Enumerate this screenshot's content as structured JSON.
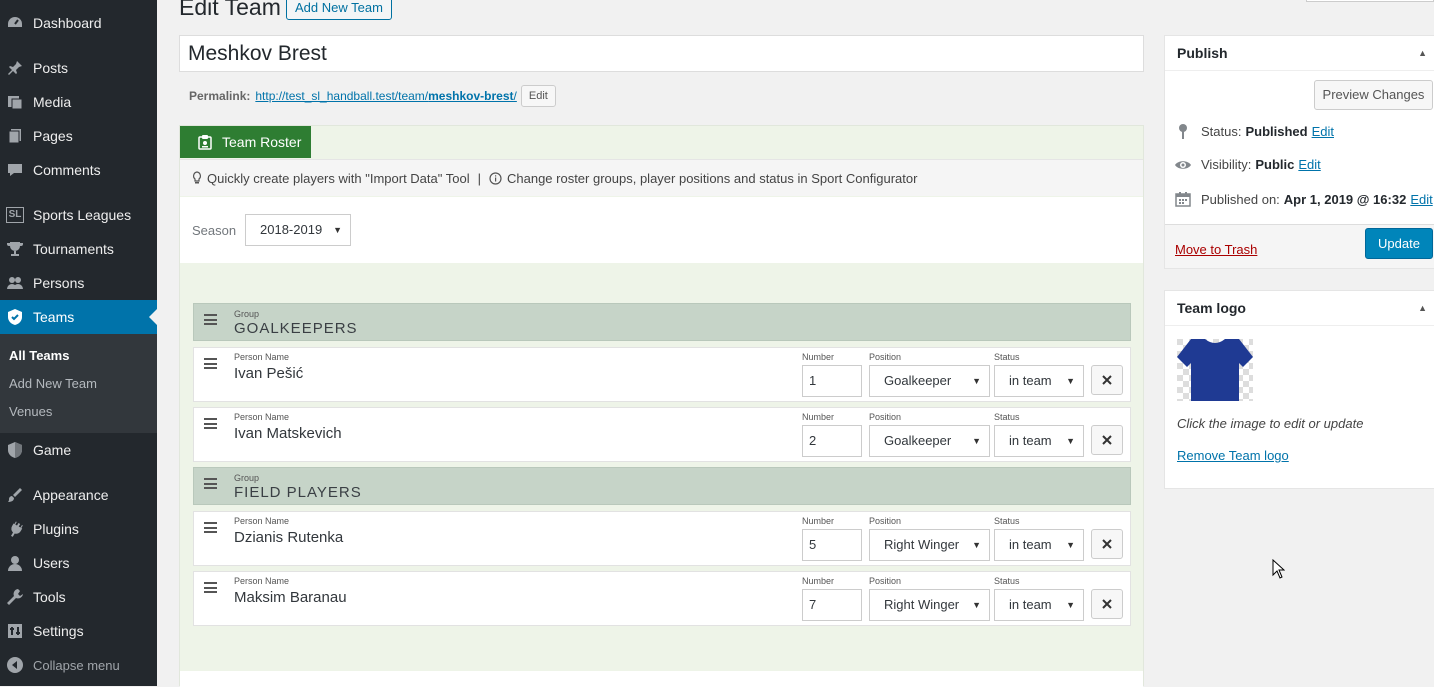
{
  "sidebar": {
    "items": [
      {
        "label": "Dashboard",
        "icon": "dashboard-icon"
      },
      {
        "label": "Posts",
        "icon": "pushpin-icon"
      },
      {
        "label": "Media",
        "icon": "media-icon"
      },
      {
        "label": "Pages",
        "icon": "pages-icon"
      },
      {
        "label": "Comments",
        "icon": "comment-icon"
      },
      {
        "label": "Sports Leagues",
        "icon": "sl-icon",
        "icon_text": "SL"
      },
      {
        "label": "Tournaments",
        "icon": "trophy-icon"
      },
      {
        "label": "Persons",
        "icon": "persons-icon"
      },
      {
        "label": "Teams",
        "icon": "shield-icon",
        "active": true
      },
      {
        "label": "Game",
        "icon": "shield-half-icon"
      },
      {
        "label": "Appearance",
        "icon": "brush-icon"
      },
      {
        "label": "Plugins",
        "icon": "plugin-icon"
      },
      {
        "label": "Users",
        "icon": "users-icon"
      },
      {
        "label": "Tools",
        "icon": "wrench-icon"
      },
      {
        "label": "Settings",
        "icon": "settings-icon"
      }
    ],
    "submenu": [
      "All Teams",
      "Add New Team",
      "Venues"
    ],
    "collapse_label": "Collapse menu"
  },
  "header": {
    "title": "Edit Team",
    "add_new_label": "Add New Team"
  },
  "post": {
    "title": "Meshkov Brest",
    "permalink_label": "Permalink:",
    "permalink_base": "http://test_sl_handball.test/team/",
    "permalink_slug": "meshkov-brest",
    "permalink_end": "/",
    "edit_label": "Edit"
  },
  "roster": {
    "tab_label": "Team Roster",
    "info_left": "Quickly create players with \"Import Data\" Tool",
    "info_separator": "|",
    "info_right": "Change roster groups, player positions and status in Sport Configurator",
    "season_label": "Season",
    "season_value": "2018-2019",
    "group_label": "Group",
    "person_label": "Person Name",
    "number_label": "Number",
    "position_label": "Position",
    "status_label": "Status",
    "groups": [
      {
        "name": "GOALKEEPERS",
        "players": [
          {
            "name": "Ivan Pešić",
            "number": "1",
            "position": "Goalkeeper",
            "status": "in team"
          },
          {
            "name": "Ivan Matskevich",
            "number": "2",
            "position": "Goalkeeper",
            "status": "in team"
          }
        ]
      },
      {
        "name": "FIELD PLAYERS",
        "players": [
          {
            "name": "Dzianis Rutenka",
            "number": "5",
            "position": "Right Winger",
            "status": "in team"
          },
          {
            "name": "Maksim Baranau",
            "number": "7",
            "position": "Right Winger",
            "status": "in team"
          }
        ]
      }
    ]
  },
  "publish": {
    "title": "Publish",
    "preview_label": "Preview Changes",
    "status_label": "Status:",
    "status_value": "Published",
    "visibility_label": "Visibility:",
    "visibility_value": "Public",
    "published_label": "Published on:",
    "published_value": "Apr 1, 2019 @ 16:32",
    "edit_label": "Edit",
    "trash_label": "Move to Trash",
    "update_label": "Update"
  },
  "team_logo": {
    "title": "Team logo",
    "hint": "Click the image to edit or update",
    "remove_label": "Remove Team logo"
  },
  "colors": {
    "sidebar_bg": "#23282d",
    "active": "#0073aa",
    "roster_tab": "#2e7d32",
    "group_bg": "#c6d4c8",
    "jersey": "#1f3a93"
  }
}
